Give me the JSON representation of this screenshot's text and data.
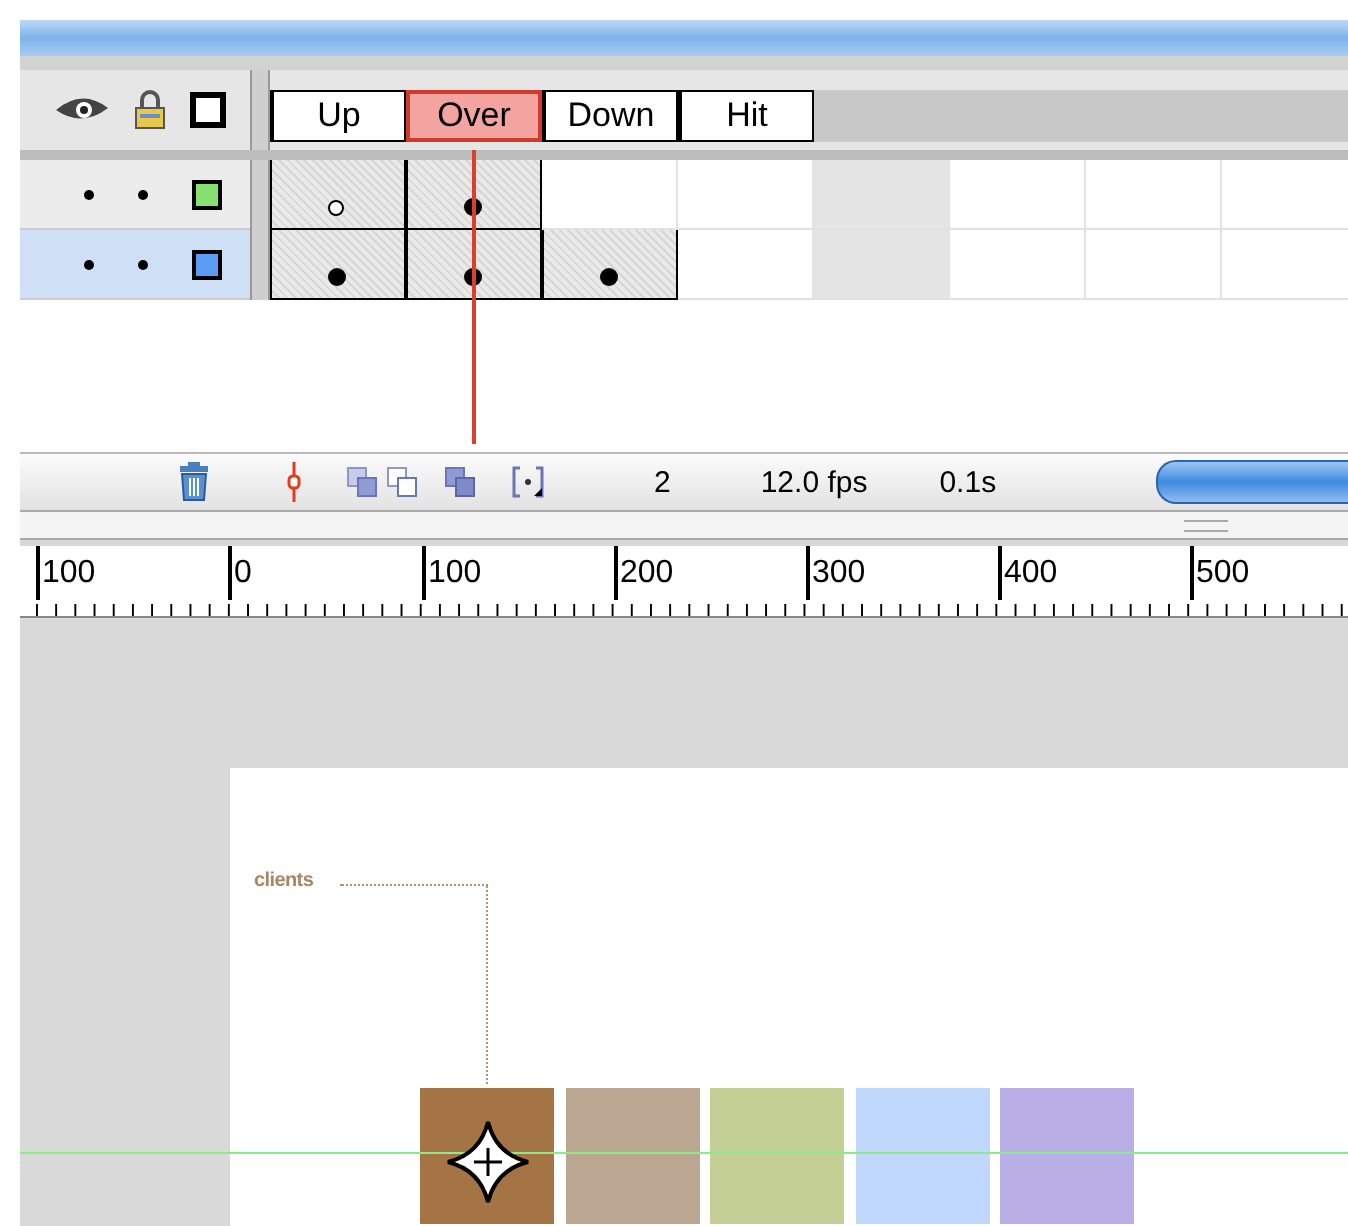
{
  "frame_tabs": [
    {
      "label": "Up",
      "selected": false
    },
    {
      "label": "Over",
      "selected": true
    },
    {
      "label": "Down",
      "selected": false
    },
    {
      "label": "Hit",
      "selected": false
    }
  ],
  "layers": [
    {
      "color": "#88e070",
      "selected": false,
      "frames": [
        {
          "kind": "empty-keyframe"
        },
        {
          "kind": "keyframe"
        }
      ]
    },
    {
      "color": "#5b9cf5",
      "selected": true,
      "frames": [
        {
          "kind": "keyframe"
        },
        {
          "kind": "keyframe"
        },
        {
          "kind": "keyframe"
        }
      ]
    }
  ],
  "status": {
    "current_frame": "2",
    "frame_rate": "12.0 fps",
    "elapsed": "0.1s"
  },
  "ruler": {
    "labels": [
      "100",
      "0",
      "100",
      "200",
      "300",
      "400",
      "500"
    ]
  },
  "stage": {
    "label": "clients",
    "swatches": [
      {
        "color": "#a57444"
      },
      {
        "color": "#bba692"
      },
      {
        "color": "#c4cf96"
      },
      {
        "color": "#c0d8fb"
      },
      {
        "color": "#b9aee6"
      }
    ]
  }
}
